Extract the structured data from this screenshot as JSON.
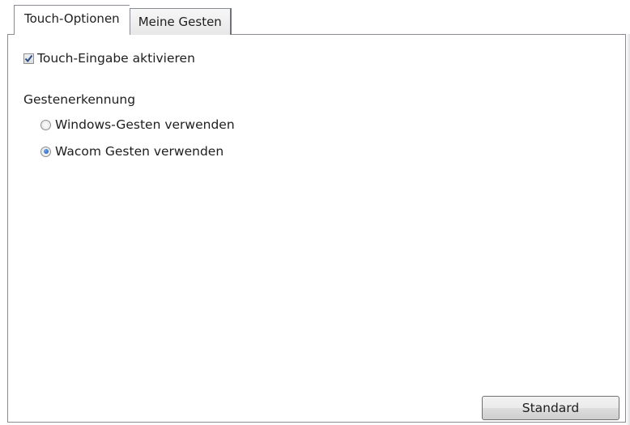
{
  "tabs": [
    {
      "label": "Touch-Optionen",
      "active": true
    },
    {
      "label": "Meine Gesten",
      "active": false
    }
  ],
  "touch_input": {
    "label": "Touch-Eingabe aktivieren",
    "checked": true
  },
  "gesture_group": {
    "label": "Gestenerkennung",
    "options": [
      {
        "label": "Windows-Gesten verwenden",
        "selected": false
      },
      {
        "label": "Wacom Gesten verwenden",
        "selected": true
      }
    ]
  },
  "default_button": {
    "label": "Standard"
  },
  "colors": {
    "border": "#898c95",
    "radio_dot": "#1c4fa8",
    "check_mark": "#2a4a8a"
  }
}
